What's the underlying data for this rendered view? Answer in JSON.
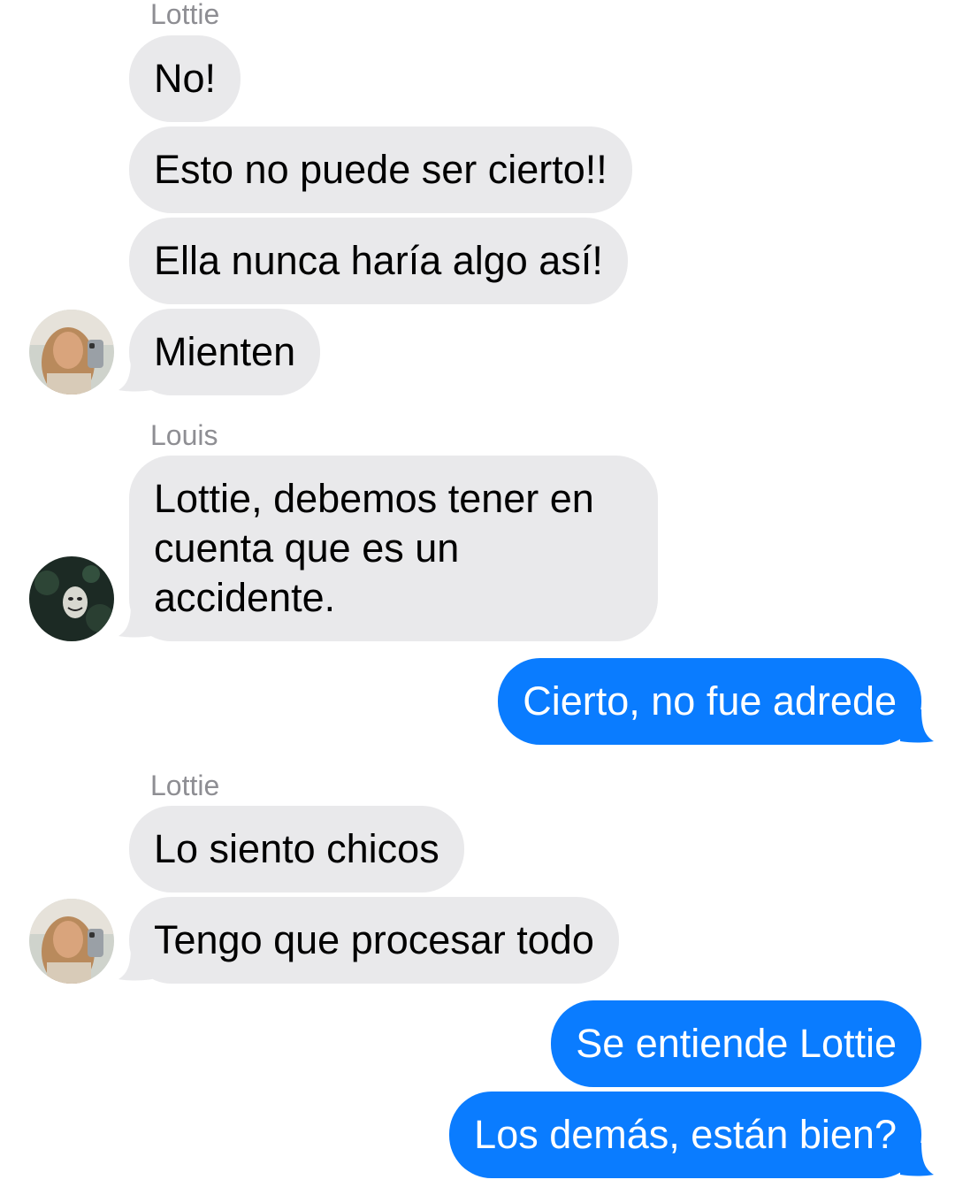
{
  "colors": {
    "incoming_bubble": "#e9e9eb",
    "outgoing_bubble": "#0a7cff",
    "sender_name": "#8e8e93"
  },
  "messages": [
    {
      "sender": "Lottie",
      "text": "No!",
      "direction": "incoming"
    },
    {
      "text": "Esto no puede ser cierto!!",
      "direction": "incoming"
    },
    {
      "text": "Ella nunca haría algo así!",
      "direction": "incoming"
    },
    {
      "text": "Mienten",
      "direction": "incoming"
    },
    {
      "sender": "Louis",
      "text": "Lottie, debemos tener en cuenta que es un accidente.",
      "direction": "incoming"
    },
    {
      "text": "Cierto, no fue adrede",
      "direction": "outgoing"
    },
    {
      "sender": "Lottie",
      "text": "Lo siento chicos",
      "direction": "incoming"
    },
    {
      "text": "Tengo que procesar todo",
      "direction": "incoming"
    },
    {
      "text": "Se entiende Lottie",
      "direction": "outgoing"
    },
    {
      "text": "Los demás, están bien?",
      "direction": "outgoing"
    }
  ],
  "avatars": [
    {
      "name": "lottie-avatar",
      "icon": "photo-portrait"
    },
    {
      "name": "louis-avatar",
      "icon": "mask-photo"
    },
    {
      "name": "lottie-avatar",
      "icon": "photo-portrait"
    }
  ]
}
